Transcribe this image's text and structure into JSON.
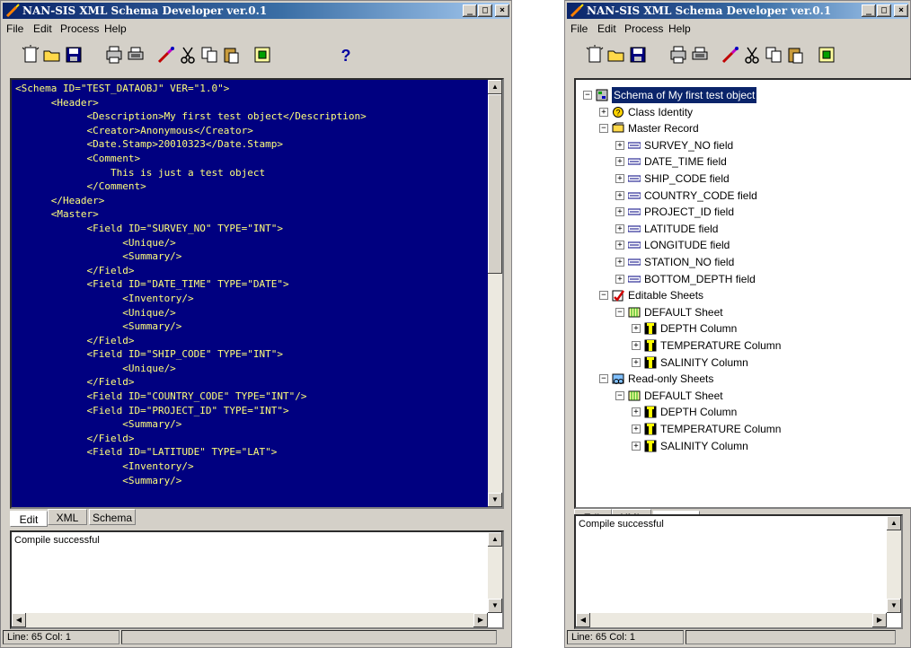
{
  "app": {
    "title": "NAN-SIS XML Schema Developer ver.0.1"
  },
  "window_controls": {
    "minimize": "_",
    "maximize": "□",
    "close": "×"
  },
  "menu": [
    "File",
    "Edit",
    "Process",
    "Help"
  ],
  "toolbar_icons": [
    "new-icon",
    "open-icon",
    "save-icon",
    "print-preview-icon",
    "print-icon",
    "compile-icon",
    "cut-icon",
    "copy-icon",
    "paste-icon",
    "properties-icon",
    "help-icon"
  ],
  "left": {
    "code_lines": [
      "<Schema ID=\"TEST_DATAOBJ\" VER=\"1.0\">",
      "      <Header>",
      "            <Description>My first test object</Description>",
      "            <Creator>Anonymous</Creator>",
      "            <Date.Stamp>20010323</Date.Stamp>",
      "            <Comment>",
      "                This is just a test object",
      "            </Comment>",
      "      </Header>",
      "      <Master>",
      "            <Field ID=\"SURVEY_NO\" TYPE=\"INT\">",
      "                  <Unique/>",
      "                  <Summary/>",
      "            </Field>",
      "            <Field ID=\"DATE_TIME\" TYPE=\"DATE\">",
      "                  <Inventory/>",
      "                  <Unique/>",
      "                  <Summary/>",
      "            </Field>",
      "            <Field ID=\"SHIP_CODE\" TYPE=\"INT\">",
      "                  <Unique/>",
      "            </Field>",
      "            <Field ID=\"COUNTRY_CODE\" TYPE=\"INT\"/>",
      "            <Field ID=\"PROJECT_ID\" TYPE=\"INT\">",
      "                  <Summary/>",
      "            </Field>",
      "            <Field ID=\"LATITUDE\" TYPE=\"LAT\">",
      "                  <Inventory/>",
      "                  <Summary/>"
    ],
    "tabs": [
      "Edit",
      "XML",
      "Schema"
    ],
    "active_tab": "Edit",
    "message": "Compile successful",
    "status": "Line: 65  Col:  1"
  },
  "right": {
    "tree": [
      {
        "label": "Schema of My first test object",
        "level": 0,
        "icon": "schema-icon",
        "expander": "−",
        "selected": true
      },
      {
        "label": "Class Identity",
        "level": 1,
        "icon": "identity-icon",
        "expander": "+"
      },
      {
        "label": "Master Record",
        "level": 1,
        "icon": "master-record-icon",
        "expander": "−"
      },
      {
        "label": "SURVEY_NO field",
        "level": 2,
        "icon": "field-icon",
        "expander": "+"
      },
      {
        "label": "DATE_TIME field",
        "level": 2,
        "icon": "field-icon",
        "expander": "+"
      },
      {
        "label": "SHIP_CODE field",
        "level": 2,
        "icon": "field-icon",
        "expander": "+"
      },
      {
        "label": "COUNTRY_CODE field",
        "level": 2,
        "icon": "field-icon",
        "expander": "+"
      },
      {
        "label": "PROJECT_ID field",
        "level": 2,
        "icon": "field-icon",
        "expander": "+"
      },
      {
        "label": "LATITUDE field",
        "level": 2,
        "icon": "field-icon",
        "expander": "+"
      },
      {
        "label": "LONGITUDE field",
        "level": 2,
        "icon": "field-icon",
        "expander": "+"
      },
      {
        "label": "STATION_NO field",
        "level": 2,
        "icon": "field-icon",
        "expander": "+"
      },
      {
        "label": "BOTTOM_DEPTH field",
        "level": 2,
        "icon": "field-icon",
        "expander": "+"
      },
      {
        "label": "Editable Sheets",
        "level": 1,
        "icon": "editable-sheets-icon",
        "expander": "−"
      },
      {
        "label": "DEFAULT Sheet",
        "level": 2,
        "icon": "sheet-icon",
        "expander": "−"
      },
      {
        "label": "DEPTH Column",
        "level": 3,
        "icon": "column-icon",
        "expander": "+"
      },
      {
        "label": "TEMPERATURE Column",
        "level": 3,
        "icon": "column-icon",
        "expander": "+"
      },
      {
        "label": "SALINITY Column",
        "level": 3,
        "icon": "column-icon",
        "expander": "+"
      },
      {
        "label": "Read-only Sheets",
        "level": 1,
        "icon": "readonly-sheets-icon",
        "expander": "−"
      },
      {
        "label": "DEFAULT Sheet",
        "level": 2,
        "icon": "sheet-icon",
        "expander": "−"
      },
      {
        "label": "DEPTH Column",
        "level": 3,
        "icon": "column-icon",
        "expander": "+"
      },
      {
        "label": "TEMPERATURE Column",
        "level": 3,
        "icon": "column-icon",
        "expander": "+"
      },
      {
        "label": "SALINITY Column",
        "level": 3,
        "icon": "column-icon",
        "expander": "+"
      }
    ],
    "tabs": [
      "Edit",
      "XML",
      "Schema"
    ],
    "active_tab": "Schema",
    "message": "Compile successful",
    "status": "Line: 65  Col:  1"
  },
  "colors": {
    "editor_bg": "#000080",
    "editor_text": "#ffff7a",
    "title_start": "#0a246a",
    "title_end": "#a6caf0",
    "face": "#d4d0c8"
  }
}
